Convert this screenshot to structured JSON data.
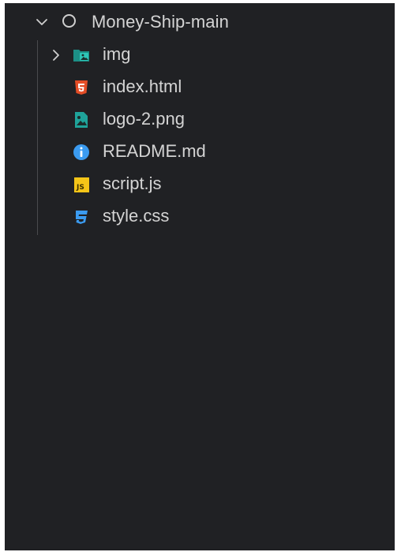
{
  "explorer": {
    "root_folder": {
      "label": "Money-Ship-main",
      "chevron_icon": "chevron-down-icon",
      "status_icon": "circle-outline-icon"
    },
    "items": [
      {
        "label": "img",
        "type": "folder",
        "icon": "image-folder-icon",
        "icon_color": "#1fa39a",
        "expanded": false
      },
      {
        "label": "index.html",
        "type": "file",
        "icon": "html5-icon",
        "icon_color": "#e44d26"
      },
      {
        "label": "logo-2.png",
        "type": "file",
        "icon": "image-file-icon",
        "icon_color": "#1fa39a"
      },
      {
        "label": "README.md",
        "type": "file",
        "icon": "info-icon",
        "icon_color": "#3b9bf0"
      },
      {
        "label": "script.js",
        "type": "file",
        "icon": "javascript-icon",
        "icon_color": "#f5c518",
        "icon_text": "JS"
      },
      {
        "label": "style.css",
        "type": "file",
        "icon": "css3-icon",
        "icon_color": "#3b9bf0"
      }
    ]
  },
  "colors": {
    "panel_background": "#202124",
    "text": "#d4d4d4"
  }
}
